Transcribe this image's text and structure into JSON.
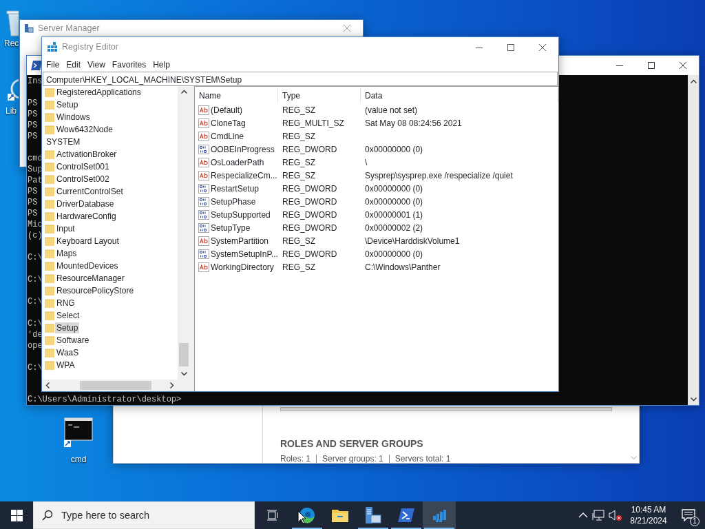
{
  "desktop_icons": [
    {
      "kind": "recycle",
      "label": "Rec"
    },
    {
      "kind": "library",
      "label": "Lib"
    },
    {
      "kind": "console",
      "label": "cmd"
    }
  ],
  "server_manager": {
    "title": "Server Manager"
  },
  "dashboard": {
    "heading": "ROLES AND SERVER GROUPS",
    "stats": [
      "Roles: 1",
      "Server groups: 1",
      "Servers total: 1"
    ]
  },
  "console": {
    "paragraphs": [
      [
        "Ins"
      ],
      [
        "PS",
        "PS",
        "PS",
        "PS"
      ],
      [
        "cmd",
        "Sup",
        "Pat",
        "PS",
        "PS",
        "PS",
        "Mic",
        "(c)"
      ],
      [
        "C:\\"
      ],
      [
        "C:\\"
      ],
      [
        "C:\\"
      ],
      [
        "C:\\",
        "'de",
        "ope"
      ],
      [
        "C:\\"
      ]
    ],
    "prompt": "C:\\Users\\Administrator\\desktop>"
  },
  "registry": {
    "title": "Registry Editor",
    "menu": [
      "File",
      "Edit",
      "View",
      "Favorites",
      "Help"
    ],
    "address": "Computer\\HKEY_LOCAL_MACHINE\\SYSTEM\\Setup",
    "tree": [
      {
        "children": [
          {
            "label": "RegisteredApplications",
            "selected": false
          },
          {
            "label": "Setup",
            "selected": false
          },
          {
            "label": "Windows",
            "selected": false
          },
          {
            "label": "Wow6432Node",
            "selected": false
          }
        ]
      },
      {
        "label": "SYSTEM",
        "selected": false,
        "children": [
          {
            "label": "ActivationBroker",
            "selected": false
          },
          {
            "label": "ControlSet001",
            "selected": false
          },
          {
            "label": "ControlSet002",
            "selected": false
          },
          {
            "label": "CurrentControlSet",
            "selected": false
          },
          {
            "label": "DriverDatabase",
            "selected": false
          },
          {
            "label": "HardwareConfig",
            "selected": false
          },
          {
            "label": "Input",
            "selected": false
          },
          {
            "label": "Keyboard Layout",
            "selected": false
          },
          {
            "label": "Maps",
            "selected": false
          },
          {
            "label": "MountedDevices",
            "selected": false
          },
          {
            "label": "ResourceManager",
            "selected": false
          },
          {
            "label": "ResourcePolicyStore",
            "selected": false
          },
          {
            "label": "RNG",
            "selected": false
          },
          {
            "label": "Select",
            "selected": false
          },
          {
            "label": "Setup",
            "selected": true
          },
          {
            "label": "Software",
            "selected": false
          },
          {
            "label": "WaaS",
            "selected": false
          },
          {
            "label": "WPA",
            "selected": false
          }
        ]
      }
    ],
    "columns": [
      "Name",
      "Type",
      "Data"
    ],
    "values": [
      {
        "kind": "string",
        "name": "(Default)",
        "type": "REG_SZ",
        "data": "(value not set)"
      },
      {
        "kind": "string",
        "name": "CloneTag",
        "type": "REG_MULTI_SZ",
        "data": "Sat May 08 08:24:56 2021"
      },
      {
        "kind": "string",
        "name": "CmdLine",
        "type": "REG_SZ"
      },
      {
        "kind": "dword",
        "name": "OOBEInProgress",
        "type": "REG_DWORD",
        "data": "0x00000000 (0)"
      },
      {
        "kind": "string",
        "name": "OsLoaderPath",
        "type": "REG_SZ",
        "data": "\\"
      },
      {
        "kind": "string",
        "name": "RespecializeCm...",
        "type": "REG_SZ",
        "data": "Sysprep\\sysprep.exe /respecialize /quiet"
      },
      {
        "kind": "dword",
        "name": "RestartSetup",
        "type": "REG_DWORD",
        "data": "0x00000000 (0)"
      },
      {
        "kind": "dword",
        "name": "SetupPhase",
        "type": "REG_DWORD",
        "data": "0x00000000 (0)"
      },
      {
        "kind": "dword",
        "name": "SetupSupported",
        "type": "REG_DWORD",
        "data": "0x00000001 (1)"
      },
      {
        "kind": "dword",
        "name": "SetupType",
        "type": "REG_DWORD",
        "data": "0x00000002 (2)"
      },
      {
        "kind": "string",
        "name": "SystemPartition",
        "type": "REG_SZ",
        "data": "\\Device\\HarddiskVolume1"
      },
      {
        "kind": "dword",
        "name": "SystemSetupInP...",
        "type": "REG_DWORD",
        "data": "0x00000000 (0)"
      },
      {
        "kind": "string",
        "name": "WorkingDirectory",
        "type": "REG_SZ",
        "data": "C:\\Windows\\Panther"
      }
    ]
  },
  "taskbar": {
    "search": {
      "placeholder": "Type here to search"
    },
    "apps": [
      {
        "kind": "taskview",
        "running": false,
        "selected": false
      },
      {
        "kind": "browser",
        "running": true,
        "selected": false
      },
      {
        "kind": "explorer",
        "running": false,
        "selected": false
      },
      {
        "kind": "server",
        "running": true,
        "selected": false
      },
      {
        "kind": "powershell",
        "running": true,
        "selected": false
      },
      {
        "kind": "registry",
        "running": true,
        "selected": true
      }
    ],
    "time": "10:45 AM",
    "date": "8/21/2024",
    "notification_count": "1"
  }
}
